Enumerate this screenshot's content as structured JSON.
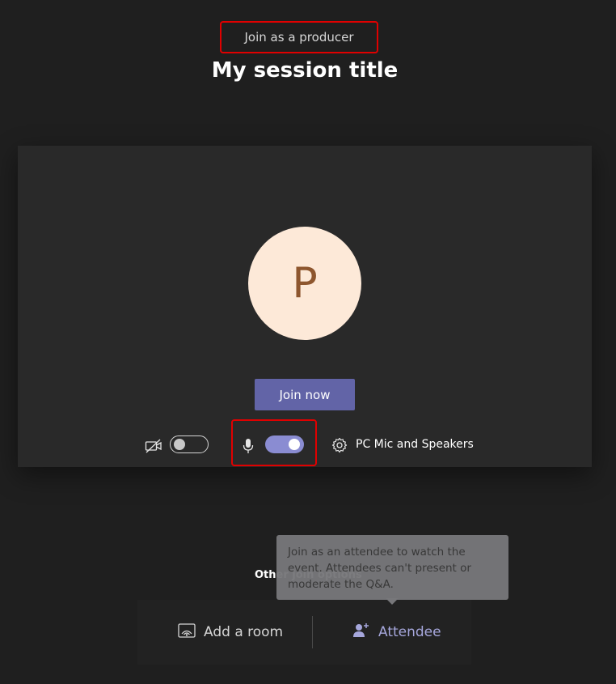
{
  "header": {
    "role_label": "Join as a producer",
    "session_title": "My session title"
  },
  "preview": {
    "avatar_initial": "P",
    "join_label": "Join now",
    "camera_toggle": "off",
    "mic_toggle": "on",
    "device_label": "PC Mic and Speakers"
  },
  "other_options": {
    "heading": "Other join options",
    "items": [
      {
        "label": "Add a room",
        "icon": "cast-room-icon"
      },
      {
        "label": "Attendee",
        "icon": "person-add-icon"
      }
    ],
    "tooltip": "Join as an attendee to watch the event. Attendees can't present or moderate the Q&A."
  },
  "colors": {
    "accent": "#6264a7",
    "toggle_on": "#8a8cd2",
    "avatar_bg": "#fde9d8",
    "avatar_fg": "#8e562e",
    "highlight": "#e00000"
  }
}
